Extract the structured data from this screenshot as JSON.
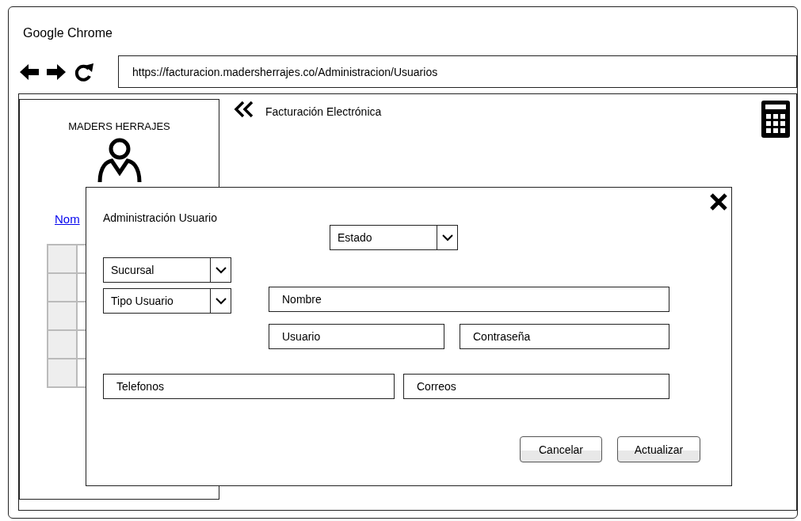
{
  "window": {
    "title": "Google Chrome"
  },
  "browser": {
    "url": "https://facturacion.madersherrajes.co/Administracion/Usuarios"
  },
  "sidebar": {
    "brand": "MADERS HERRAJES",
    "link": "Nom"
  },
  "header": {
    "title": "Facturación Electrónica"
  },
  "dialog": {
    "title": "Administración Usuario",
    "estado": {
      "placeholder": "Estado"
    },
    "dropdowns": [
      {
        "placeholder": "Sucursal"
      },
      {
        "placeholder": "Tipo Usuario"
      }
    ],
    "nombre": {
      "placeholder": "Nombre"
    },
    "usuario": {
      "placeholder": "Usuario"
    },
    "contrasena": {
      "placeholder": "Contraseña"
    },
    "telefonos": {
      "placeholder": "Telefonos"
    },
    "correos": {
      "placeholder": "Correos"
    },
    "buttons": [
      "Cancelar",
      "Actualizar"
    ]
  }
}
